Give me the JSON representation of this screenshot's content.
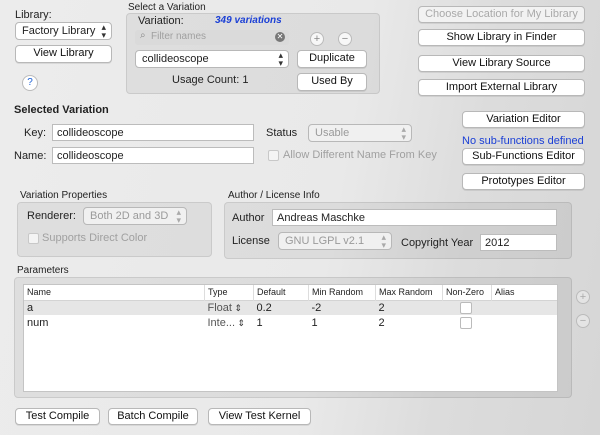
{
  "library": {
    "label": "Library:",
    "selected": "Factory Library",
    "view_button": "View Library",
    "help": "?"
  },
  "variation_select": {
    "group_title": "Select a Variation",
    "variation_label": "Variation:",
    "count_text": "349  variations",
    "filter_placeholder": "Filter names",
    "selected": "collideoscope",
    "usage_count": "Usage Count: 1",
    "add_symbol": "+",
    "remove_symbol": "−",
    "duplicate_button": "Duplicate",
    "used_by_button": "Used By"
  },
  "right_buttons": {
    "choose_location": "Choose Location for My Library",
    "show_in_finder": "Show Library in Finder",
    "view_source": "View Library Source",
    "import_external": "Import External Library",
    "variation_editor": "Variation Editor",
    "no_subfunctions": "No sub-functions defined",
    "subfunctions_editor": "Sub-Functions Editor",
    "prototypes_editor": "Prototypes  Editor"
  },
  "selected_variation": {
    "heading": "Selected Variation",
    "key_label": "Key:",
    "key_value": "collideoscope",
    "name_label": "Name:",
    "name_value": "collideoscope",
    "status_label": "Status",
    "status_value": "Usable",
    "allow_diff_name": "Allow Different Name From Key"
  },
  "variation_properties": {
    "title": "Variation Properties",
    "renderer_label": "Renderer:",
    "renderer_value": "Both 2D and 3D",
    "direct_color": "Supports Direct Color"
  },
  "author": {
    "title": "Author / License Info",
    "author_label": "Author",
    "author_value": "Andreas Maschke",
    "license_label": "License",
    "license_value": "GNU LGPL v2.1",
    "year_label": "Copyright Year",
    "year_value": "2012"
  },
  "parameters": {
    "title": "Parameters",
    "columns": [
      "Name",
      "Type",
      "Default",
      "Min Random",
      "Max Random",
      "Non-Zero",
      "Alias"
    ],
    "rows": [
      {
        "name": "a",
        "type": "Float",
        "default": "0.2",
        "min": "-2",
        "max": "2"
      },
      {
        "name": "num",
        "type": "Inte...",
        "default": "1",
        "min": "1",
        "max": "2"
      }
    ],
    "add_symbol": "+",
    "remove_symbol": "−"
  },
  "bottom_buttons": {
    "test_compile": "Test Compile",
    "batch_compile": "Batch Compile",
    "view_test_kernel": "View Test Kernel"
  },
  "colors": {
    "accent_blue": "#1a3fd6",
    "group_bg": "rgba(0,0,0,0.055)"
  }
}
